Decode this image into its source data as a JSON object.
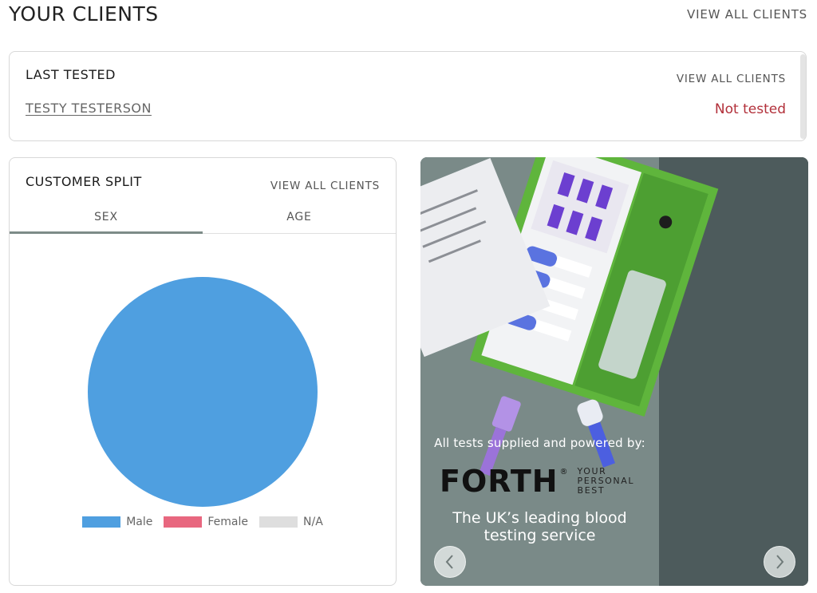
{
  "header": {
    "title": "YOUR CLIENTS",
    "view_all": "VIEW ALL CLIENTS"
  },
  "last_tested": {
    "heading": "LAST TESTED",
    "view_all": "VIEW ALL CLIENTS",
    "client_name": "TESTY TESTERSON",
    "status": "Not tested",
    "status_color": "#b2303a"
  },
  "customer_split": {
    "heading": "CUSTOMER SPLIT",
    "view_all": "VIEW ALL CLIENTS",
    "tabs": [
      {
        "label": "SEX",
        "active": true
      },
      {
        "label": "AGE",
        "active": false
      }
    ]
  },
  "chart_data": {
    "type": "pie",
    "categories": [
      "Male",
      "Female",
      "N/A"
    ],
    "values": [
      100,
      0,
      0
    ],
    "colors": [
      "#4f9fe0",
      "#e8677f",
      "#dedede"
    ],
    "legend_position": "bottom"
  },
  "promo": {
    "supplied_text": "All tests supplied and powered by:",
    "logo_word": "FORTH",
    "logo_registered": "®",
    "logo_tagline": [
      "YOUR",
      "PERSONAL",
      "BEST"
    ],
    "tagline": [
      "The UK’s leading blood",
      "testing service"
    ],
    "prev_icon": "chevron-left-icon",
    "next_icon": "chevron-right-icon"
  }
}
